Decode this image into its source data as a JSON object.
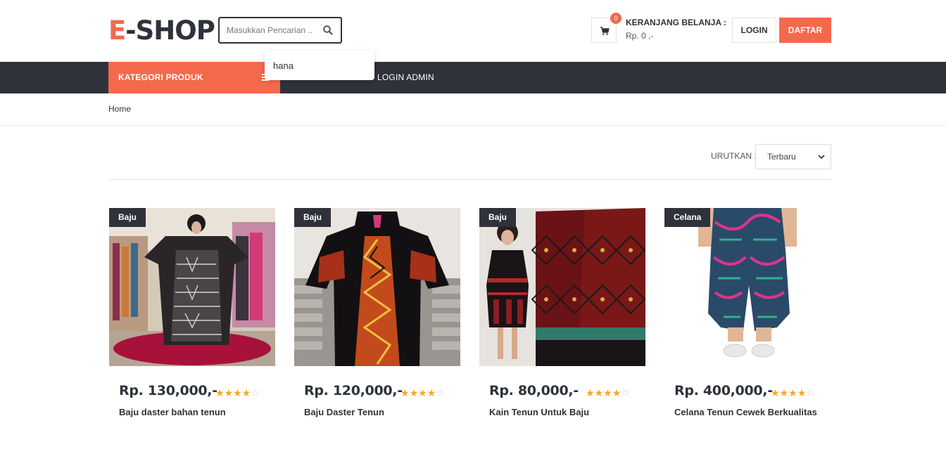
{
  "header": {
    "logo_accent": "E",
    "logo_rest": "-SHOP",
    "search": {
      "placeholder": "Masukkan Pencarian ..",
      "value": ""
    },
    "suggestion": "hana",
    "cart": {
      "count": "0",
      "title": "KERANJANG BELANJA :",
      "total": "Rp. 0 ,-"
    },
    "login_label": "LOGIN",
    "daftar_label": "DAFTAR"
  },
  "nav": {
    "category_label": "KATEGORI PRODUK",
    "admin_label": "LOGIN ADMIN"
  },
  "breadcrumb": {
    "home": "Home"
  },
  "sort": {
    "label": "URUTKAN :",
    "selected": "Terbaru"
  },
  "products": [
    {
      "tag": "Baju",
      "price": "Rp. 130,000,-",
      "rating": 4,
      "name": "Baju daster bahan tenun"
    },
    {
      "tag": "Baju",
      "price": "Rp. 120,000,-",
      "rating": 4,
      "name": "Baju Daster Tenun"
    },
    {
      "tag": "Baju",
      "price": "Rp. 80,000,-",
      "rating": 4,
      "name": "Kain Tenun Untuk Baju"
    },
    {
      "tag": "Celana",
      "price": "Rp. 400,000,-",
      "rating": 4,
      "name": "Celana Tenun Cewek Berkualitas"
    }
  ],
  "colors": {
    "accent": "#f4694c",
    "dark": "#2f323a",
    "star": "#f5a623"
  },
  "icons": {
    "search": "search-icon",
    "cart": "cart-icon",
    "menu": "menu-icon",
    "chevron": "chevron-down-icon",
    "star": "star-icon"
  }
}
